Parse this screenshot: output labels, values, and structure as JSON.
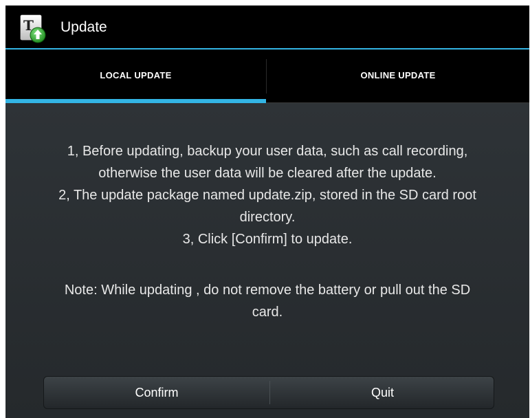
{
  "action_bar": {
    "title": "Update",
    "icon": "update-app-icon",
    "accent_color": "#33b5e5"
  },
  "tabs": [
    {
      "label": "LOCAL UPDATE",
      "selected": true
    },
    {
      "label": "ONLINE UPDATE",
      "selected": false
    }
  ],
  "message": {
    "line1": "1, Before updating, backup your user data, such as call recording,",
    "line2": "otherwise the user data will be cleared after the update.",
    "line3": "2, The update package named update.zip, stored in the SD card root",
    "line4": "directory.",
    "line5": "3, Click [Confirm] to update.",
    "note_line1": "Note: While updating , do not remove the battery or pull out the SD",
    "note_line2": "card."
  },
  "buttons": {
    "confirm_label": "Confirm",
    "quit_label": "Quit"
  }
}
